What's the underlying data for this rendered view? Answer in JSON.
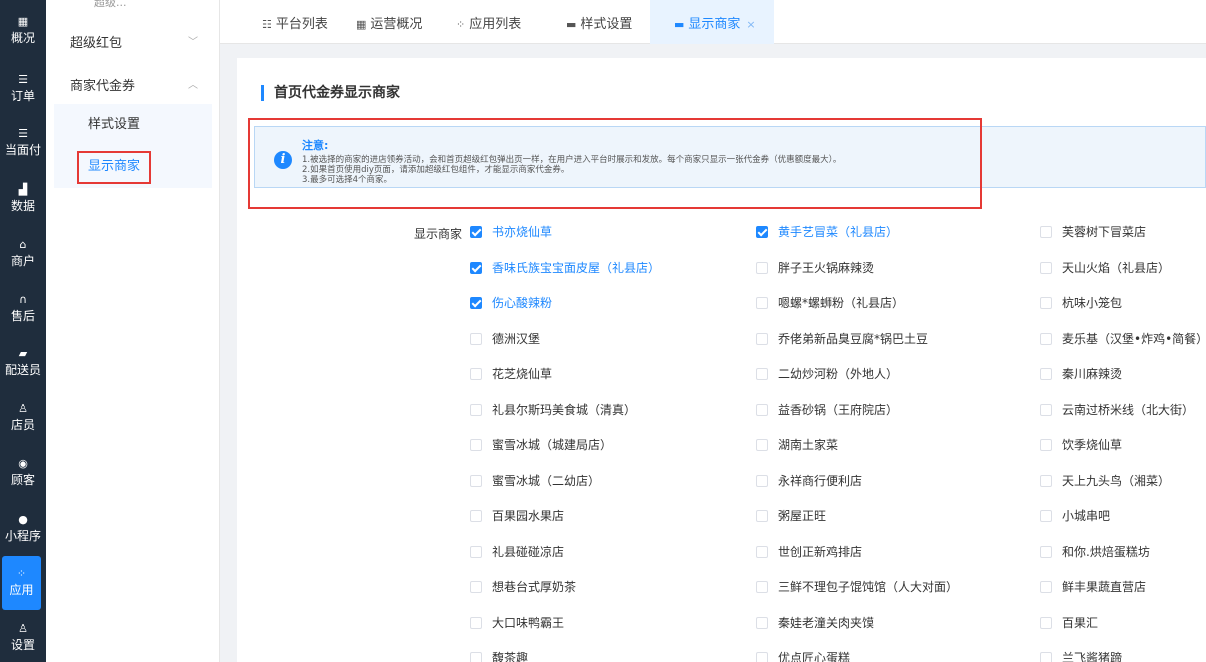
{
  "nav": [
    {
      "icon": "dashboard-icon",
      "glyph": "▦",
      "label": "概况"
    },
    {
      "icon": "order-list-icon",
      "glyph": "☰",
      "label": "订单"
    },
    {
      "icon": "payment-list-icon",
      "glyph": "☰",
      "label": "当面付"
    },
    {
      "icon": "bar-chart-icon",
      "glyph": "▟",
      "label": "数据"
    },
    {
      "icon": "store-icon",
      "glyph": "⌂",
      "label": "商户"
    },
    {
      "icon": "headset-icon",
      "glyph": "∩",
      "label": "售后"
    },
    {
      "icon": "delivery-icon",
      "glyph": "▰",
      "label": "配送员"
    },
    {
      "icon": "staff-icon",
      "glyph": "♙",
      "label": "店员"
    },
    {
      "icon": "customer-icon",
      "glyph": "◉",
      "label": "顾客"
    },
    {
      "icon": "mini-program-icon",
      "glyph": "●",
      "label": "小程序"
    },
    {
      "icon": "apps-icon",
      "glyph": "⁘",
      "label": "应用"
    },
    {
      "icon": "settings-icon",
      "glyph": "♙",
      "label": "设置"
    }
  ],
  "submenu": {
    "top_cut": "超级...",
    "group1": "超级红包",
    "group2": "商家代金券",
    "items": [
      "样式设置",
      "显示商家"
    ]
  },
  "tabs": [
    {
      "icon": "list-icon",
      "glyph": "☷",
      "label": "平台列表"
    },
    {
      "icon": "grid-icon",
      "glyph": "▦",
      "label": "运营概况"
    },
    {
      "icon": "apps-icon",
      "glyph": "⁘",
      "label": "应用列表"
    },
    {
      "icon": "style-icon",
      "glyph": "▬",
      "label": "样式设置"
    },
    {
      "icon": "store-tab-icon",
      "glyph": "▬",
      "label": "显示商家"
    }
  ],
  "page": {
    "title": "首页代金券显示商家",
    "notice_title": "注意:",
    "notice_lines": [
      "1.被选择的商家的进店领券活动，会和首页超级红包弹出页一样，在用户进入平台时展示和发放。每个商家只显示一张代金券（优惠额度最大）。",
      "2.如果首页使用diy页面，请添加超级红包组件，才能显示商家代金券。",
      "3.最多可选择4个商家。"
    ],
    "field_label": "显示商家"
  },
  "merchants": [
    [
      {
        "name": "书亦烧仙草",
        "checked": true
      },
      {
        "name": "黄手艺冒菜（礼县店）",
        "checked": true
      },
      {
        "name": "芙蓉树下冒菜店",
        "checked": false
      }
    ],
    [
      {
        "name": "香味氏族宝宝面皮屋（礼县店）",
        "checked": true
      },
      {
        "name": "胖子王火锅麻辣烫",
        "checked": false
      },
      {
        "name": "天山火焰（礼县店）",
        "checked": false
      }
    ],
    [
      {
        "name": "伤心酸辣粉",
        "checked": true
      },
      {
        "name": "嗯螺*螺蛳粉（礼县店）",
        "checked": false
      },
      {
        "name": "杭味小笼包",
        "checked": false
      }
    ],
    [
      {
        "name": "德洲汉堡",
        "checked": false
      },
      {
        "name": "乔佬弟新品臭豆腐*锅巴土豆",
        "checked": false
      },
      {
        "name": "麦乐基（汉堡•炸鸡•简餐）",
        "checked": false
      }
    ],
    [
      {
        "name": "花芝烧仙草",
        "checked": false
      },
      {
        "name": "二幼炒河粉（外地人）",
        "checked": false
      },
      {
        "name": "秦川麻辣烫",
        "checked": false
      }
    ],
    [
      {
        "name": "礼县尔斯玛美食城（清真）",
        "checked": false
      },
      {
        "name": "益香砂锅（王府院店）",
        "checked": false
      },
      {
        "name": "云南过桥米线（北大街）",
        "checked": false
      }
    ],
    [
      {
        "name": "蜜雪冰城（城建局店）",
        "checked": false
      },
      {
        "name": "湖南土家菜",
        "checked": false
      },
      {
        "name": "饮季烧仙草",
        "checked": false
      }
    ],
    [
      {
        "name": "蜜雪冰城（二幼店）",
        "checked": false
      },
      {
        "name": "永祥商行便利店",
        "checked": false
      },
      {
        "name": "天上九头鸟（湘菜）",
        "checked": false
      }
    ],
    [
      {
        "name": "百果园水果店",
        "checked": false
      },
      {
        "name": "粥屋正旺",
        "checked": false
      },
      {
        "name": "小城串吧",
        "checked": false
      }
    ],
    [
      {
        "name": "礼县碰碰凉店",
        "checked": false
      },
      {
        "name": "世创正新鸡排店",
        "checked": false
      },
      {
        "name": "和你.烘焙蛋糕坊",
        "checked": false
      }
    ],
    [
      {
        "name": "想巷台式厚奶茶",
        "checked": false
      },
      {
        "name": "三鲜不理包子馄饨馆（人大对面）",
        "checked": false
      },
      {
        "name": "鲜丰果蔬直营店",
        "checked": false
      }
    ],
    [
      {
        "name": "大口味鸭霸王",
        "checked": false
      },
      {
        "name": "秦娃老潼关肉夹馍",
        "checked": false
      },
      {
        "name": "百果汇",
        "checked": false
      }
    ],
    [
      {
        "name": "馥茶趣",
        "checked": false
      },
      {
        "name": "优点匠心蛋糕",
        "checked": false
      },
      {
        "name": "兰飞酱猪蹄",
        "checked": false
      }
    ]
  ]
}
